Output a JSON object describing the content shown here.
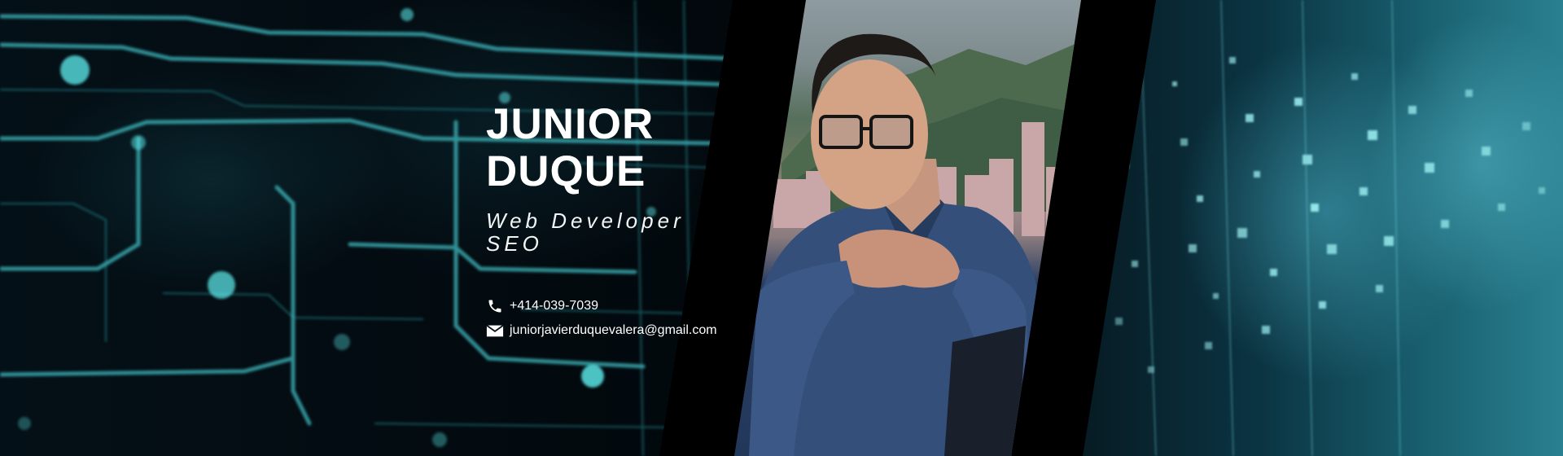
{
  "profile": {
    "first_name": "JUNIOR",
    "last_name": "DUQUE",
    "role_line_1": "Web Developer",
    "role_line_2": "SEO"
  },
  "contact": {
    "phone": "+414-039-7039",
    "email": "juniorjavierduquevalera@gmail.com"
  },
  "icons": {
    "phone": "phone-icon",
    "email": "envelope-icon"
  },
  "colors": {
    "accent_cyan": "#3fd1d6",
    "text": "#ffffff",
    "band": "#000000"
  }
}
